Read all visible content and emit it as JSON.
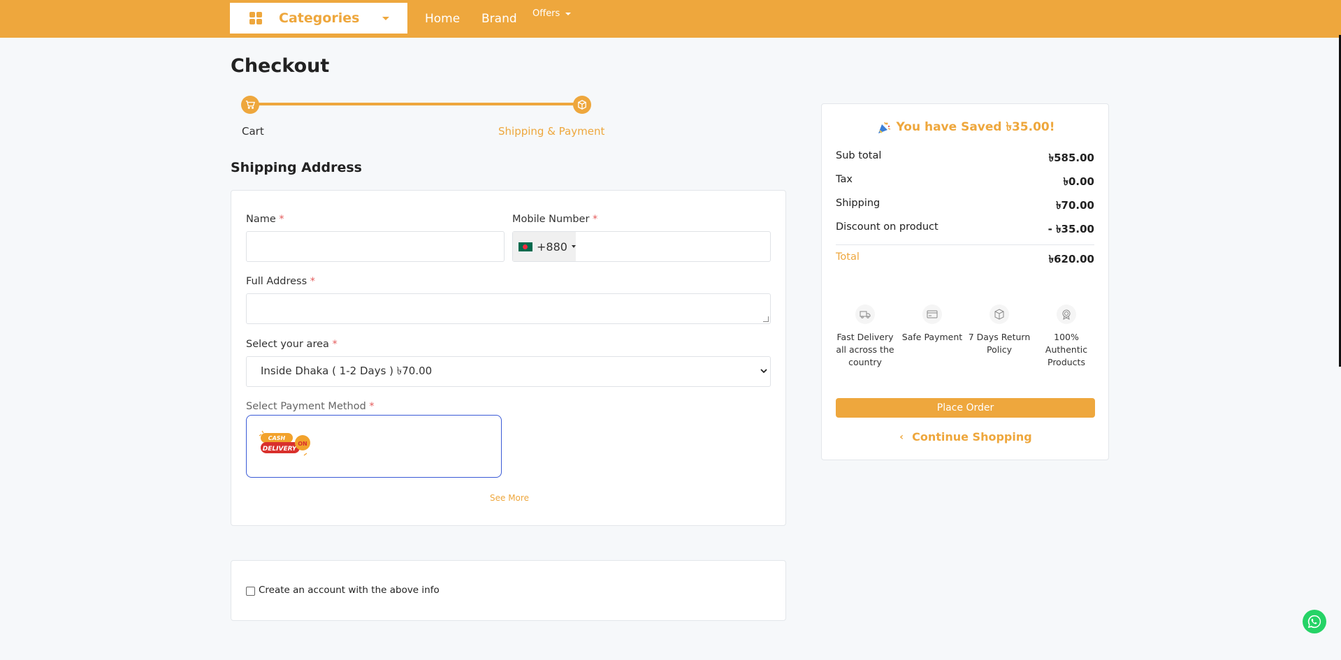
{
  "nav": {
    "categories_label": "Categories",
    "links": {
      "home": "Home",
      "brand": "Brand",
      "offers": "Offers"
    }
  },
  "page": {
    "title": "Checkout"
  },
  "steps": [
    {
      "label": "Cart",
      "icon": "cart-icon",
      "active": false
    },
    {
      "label": "Shipping & Payment",
      "icon": "box-icon",
      "active": true
    }
  ],
  "shipping": {
    "title": "Shipping Address",
    "name_label": "Name",
    "mobile_label": "Mobile Number",
    "country_code": "+880",
    "address_label": "Full Address",
    "area_label": "Select your area",
    "area_selected": "Inside Dhaka ( 1-2 Days ) ৳70.00",
    "payment_label": "Select Payment Method",
    "payment_option": "cash-on-delivery-logo",
    "see_more": "See More",
    "required_mark": "*"
  },
  "account": {
    "create_label": "Create an account with the above info"
  },
  "summary": {
    "saved_text": "You have Saved ৳35.00!",
    "rows": [
      {
        "label": "Sub total",
        "value": "৳585.00"
      },
      {
        "label": "Tax",
        "value": "৳0.00"
      },
      {
        "label": "Shipping",
        "value": "৳70.00"
      },
      {
        "label": "Discount on product",
        "value": "- ৳35.00"
      }
    ],
    "total": {
      "label": "Total",
      "value": "৳620.00"
    },
    "features": [
      {
        "text": "Fast Delivery all across the country",
        "icon": "truck-icon"
      },
      {
        "text": "Safe Payment",
        "icon": "card-icon"
      },
      {
        "text": "7 Days Return Policy",
        "icon": "return-box-icon"
      },
      {
        "text": "100% Authentic Products",
        "icon": "badge-icon"
      }
    ],
    "place_order": "Place Order",
    "continue_shopping": "Continue Shopping"
  },
  "colors": {
    "accent": "#eea73d",
    "background": "#f6f8fa",
    "whatsapp": "#25d366"
  }
}
